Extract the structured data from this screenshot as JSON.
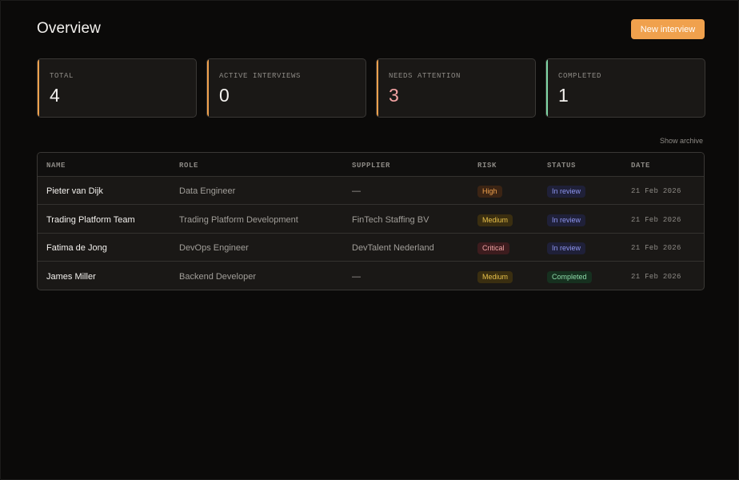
{
  "header": {
    "title": "Overview",
    "new_interview_label": "New interview"
  },
  "stats": [
    {
      "label": "TOTAL",
      "value": "4",
      "accent": "#f0a14d",
      "value_color": "#f3f1ee"
    },
    {
      "label": "ACTIVE INTERVIEWS",
      "value": "0",
      "accent": "#f0a14d",
      "value_color": "#f3f1ee"
    },
    {
      "label": "NEEDS ATTENTION",
      "value": "3",
      "accent": "#f0a14d",
      "value_color": "#f4a3a3"
    },
    {
      "label": "COMPLETED",
      "value": "1",
      "accent": "#7fd6a5",
      "value_color": "#f3f1ee"
    }
  ],
  "archive_label": "Show archive",
  "table": {
    "columns": [
      "NAME",
      "ROLE",
      "SUPPLIER",
      "RISK",
      "STATUS",
      "DATE"
    ],
    "rows": [
      {
        "name": "Pieter van Dijk",
        "role": "Data Engineer",
        "supplier": "—",
        "risk": "High",
        "status": "In review",
        "date": "21 Feb 2026"
      },
      {
        "name": "Trading Platform Team",
        "role": "Trading Platform Development",
        "supplier": "FinTech Staffing BV",
        "risk": "Medium",
        "status": "In review",
        "date": "21 Feb 2026"
      },
      {
        "name": "Fatima de Jong",
        "role": "DevOps Engineer",
        "supplier": "DevTalent Nederland",
        "risk": "Critical",
        "status": "In review",
        "date": "21 Feb 2026"
      },
      {
        "name": "James Miller",
        "role": "Backend Developer",
        "supplier": "—",
        "risk": "Medium",
        "status": "Completed",
        "date": "21 Feb 2026"
      }
    ]
  },
  "badge_colors": {
    "High": {
      "bg": "#3b2414",
      "fg": "#f0a14d"
    },
    "Medium": {
      "bg": "#3a2e10",
      "fg": "#e8c14a"
    },
    "Critical": {
      "bg": "#3d1c1e",
      "fg": "#f0a3a3"
    },
    "In review": {
      "bg": "#1f2038",
      "fg": "#8e95f0"
    },
    "Completed": {
      "bg": "#16301f",
      "fg": "#8fdcab"
    }
  }
}
